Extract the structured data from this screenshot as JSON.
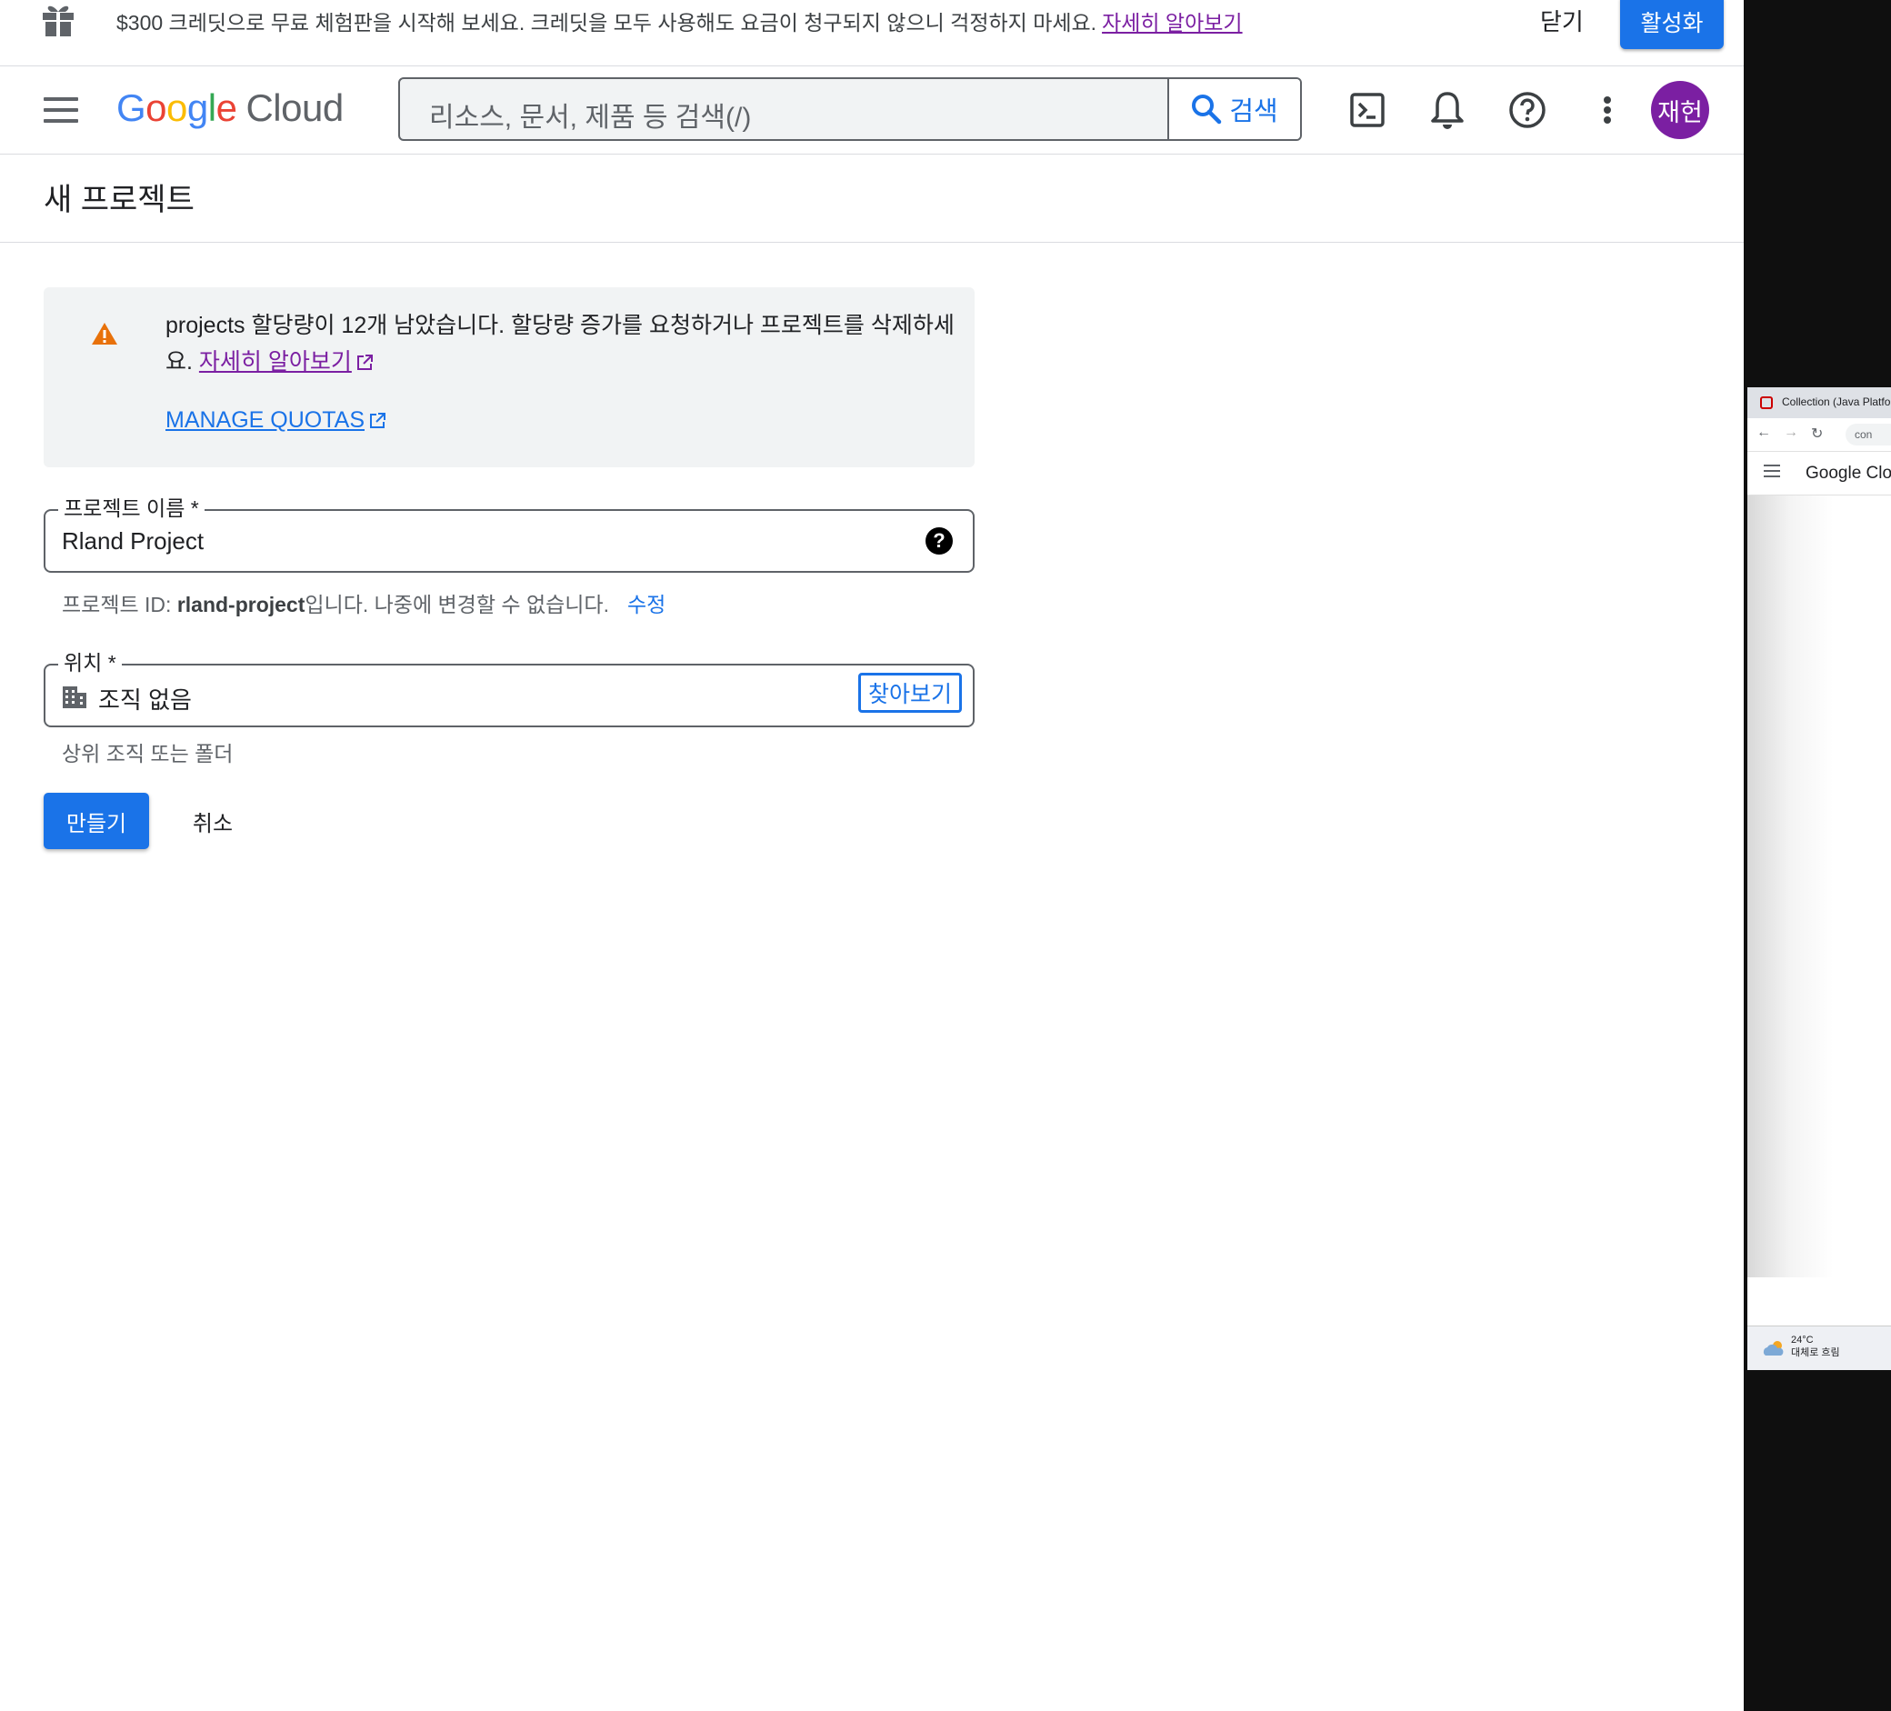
{
  "promo": {
    "message": "$300 크레딧으로 무료 체험판을 시작해 보세요. 크레딧을 모두 사용해도 요금이 청구되지 않으니 걱정하지 마세요.",
    "link": "자세히 알아보기",
    "close": "닫기",
    "activate": "활성화"
  },
  "header": {
    "logo_g1": "G",
    "logo_g2": "o",
    "logo_g3": "o",
    "logo_g4": "g",
    "logo_g5": "l",
    "logo_g6": "e",
    "logo_product": "Cloud",
    "search_placeholder": "리소스, 문서, 제품 등 검색(/)",
    "search_button": "검색",
    "avatar_initials": "재헌"
  },
  "page": {
    "title": "새 프로젝트"
  },
  "warning": {
    "text": "projects 할당량이 12개 남았습니다. 할당량 증가를 요청하거나 프로젝트를 삭제하세요.",
    "learn_more": "자세히 알아보기",
    "manage_quotas": "MANAGE QUOTAS"
  },
  "form": {
    "project_name_label": "프로젝트 이름 *",
    "project_name_value": "Rland Project",
    "help": "?",
    "project_id_prefix": "프로젝트 ID: ",
    "project_id_value": "rland-project",
    "project_id_suffix": "입니다. 나중에 변경할 수 없습니다.",
    "project_id_edit": "수정",
    "location_label": "위치 *",
    "location_value": "조직 없음",
    "browse": "찾아보기",
    "location_hint": "상위 조직 또는 폴더",
    "create": "만들기",
    "cancel": "취소"
  },
  "side_window": {
    "tab_title": "Collection (Java Platfo",
    "url": "con",
    "logo": "Google Clo",
    "weather_temp": "24°C",
    "weather_desc": "대체로 흐림"
  },
  "colors": {
    "primary": "#1a73e8",
    "link_visited": "#7b1fa2",
    "warning": "#e8710a",
    "avatar": "#7b1fa2"
  },
  "icons": [
    "gift-icon",
    "menu-icon",
    "search-icon",
    "terminal-icon",
    "bell-icon",
    "help-icon",
    "more-vert-icon",
    "warning-icon",
    "external-link-icon",
    "help-circle-icon",
    "building-icon"
  ]
}
